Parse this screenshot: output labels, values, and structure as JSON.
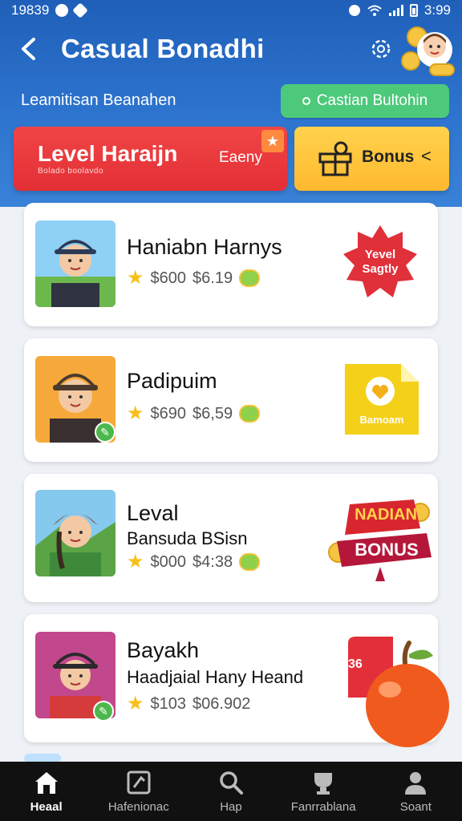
{
  "status_bar": {
    "time_left": "19839",
    "time_right": "3:99"
  },
  "header": {
    "title": "Casual Bonadhi",
    "subtitle": "Leamitisan Beanahen",
    "action_button": "Castian Bultohin"
  },
  "tabs": {
    "level": {
      "label": "Level Haraijn",
      "small_text": "Bolado boolavdo",
      "difficulty": "Eaeny"
    },
    "bonus": {
      "label": "Bonus",
      "chevron": "<"
    }
  },
  "cards": [
    {
      "name": "Haniabn Harnys",
      "price": "$600",
      "value": "$6.19",
      "badge_text": "Yevel Sagtly"
    },
    {
      "name": "Padipuim",
      "price": "$690",
      "value": "$6,59",
      "badge_text": "Bamoam"
    },
    {
      "name": "Leval",
      "subtitle": "Bansuda BSisn",
      "price": "$000",
      "value": "$4:38",
      "badge_top": "NADIAN",
      "badge_bottom": "BONUS"
    },
    {
      "name": "Bayakh",
      "subtitle": "Haadjaial Hany Heand",
      "price": "$103",
      "value": "$06.902",
      "badge_text": "36"
    }
  ],
  "bottom_nav": [
    {
      "label": "Heaal",
      "icon": "home-icon",
      "active": true
    },
    {
      "label": "Hafenionac",
      "icon": "puzzle-icon",
      "active": false
    },
    {
      "label": "Hap",
      "icon": "search-icon",
      "active": false
    },
    {
      "label": "Fanrrablana",
      "icon": "trophy-icon",
      "active": false
    },
    {
      "label": "Soant",
      "icon": "profile-icon",
      "active": false
    }
  ],
  "colors": {
    "header_blue": "#2d74cf",
    "level_red": "#e32f36",
    "bonus_yellow": "#ffc23d",
    "action_green": "#4cc97a",
    "nav_bg": "#111111"
  }
}
